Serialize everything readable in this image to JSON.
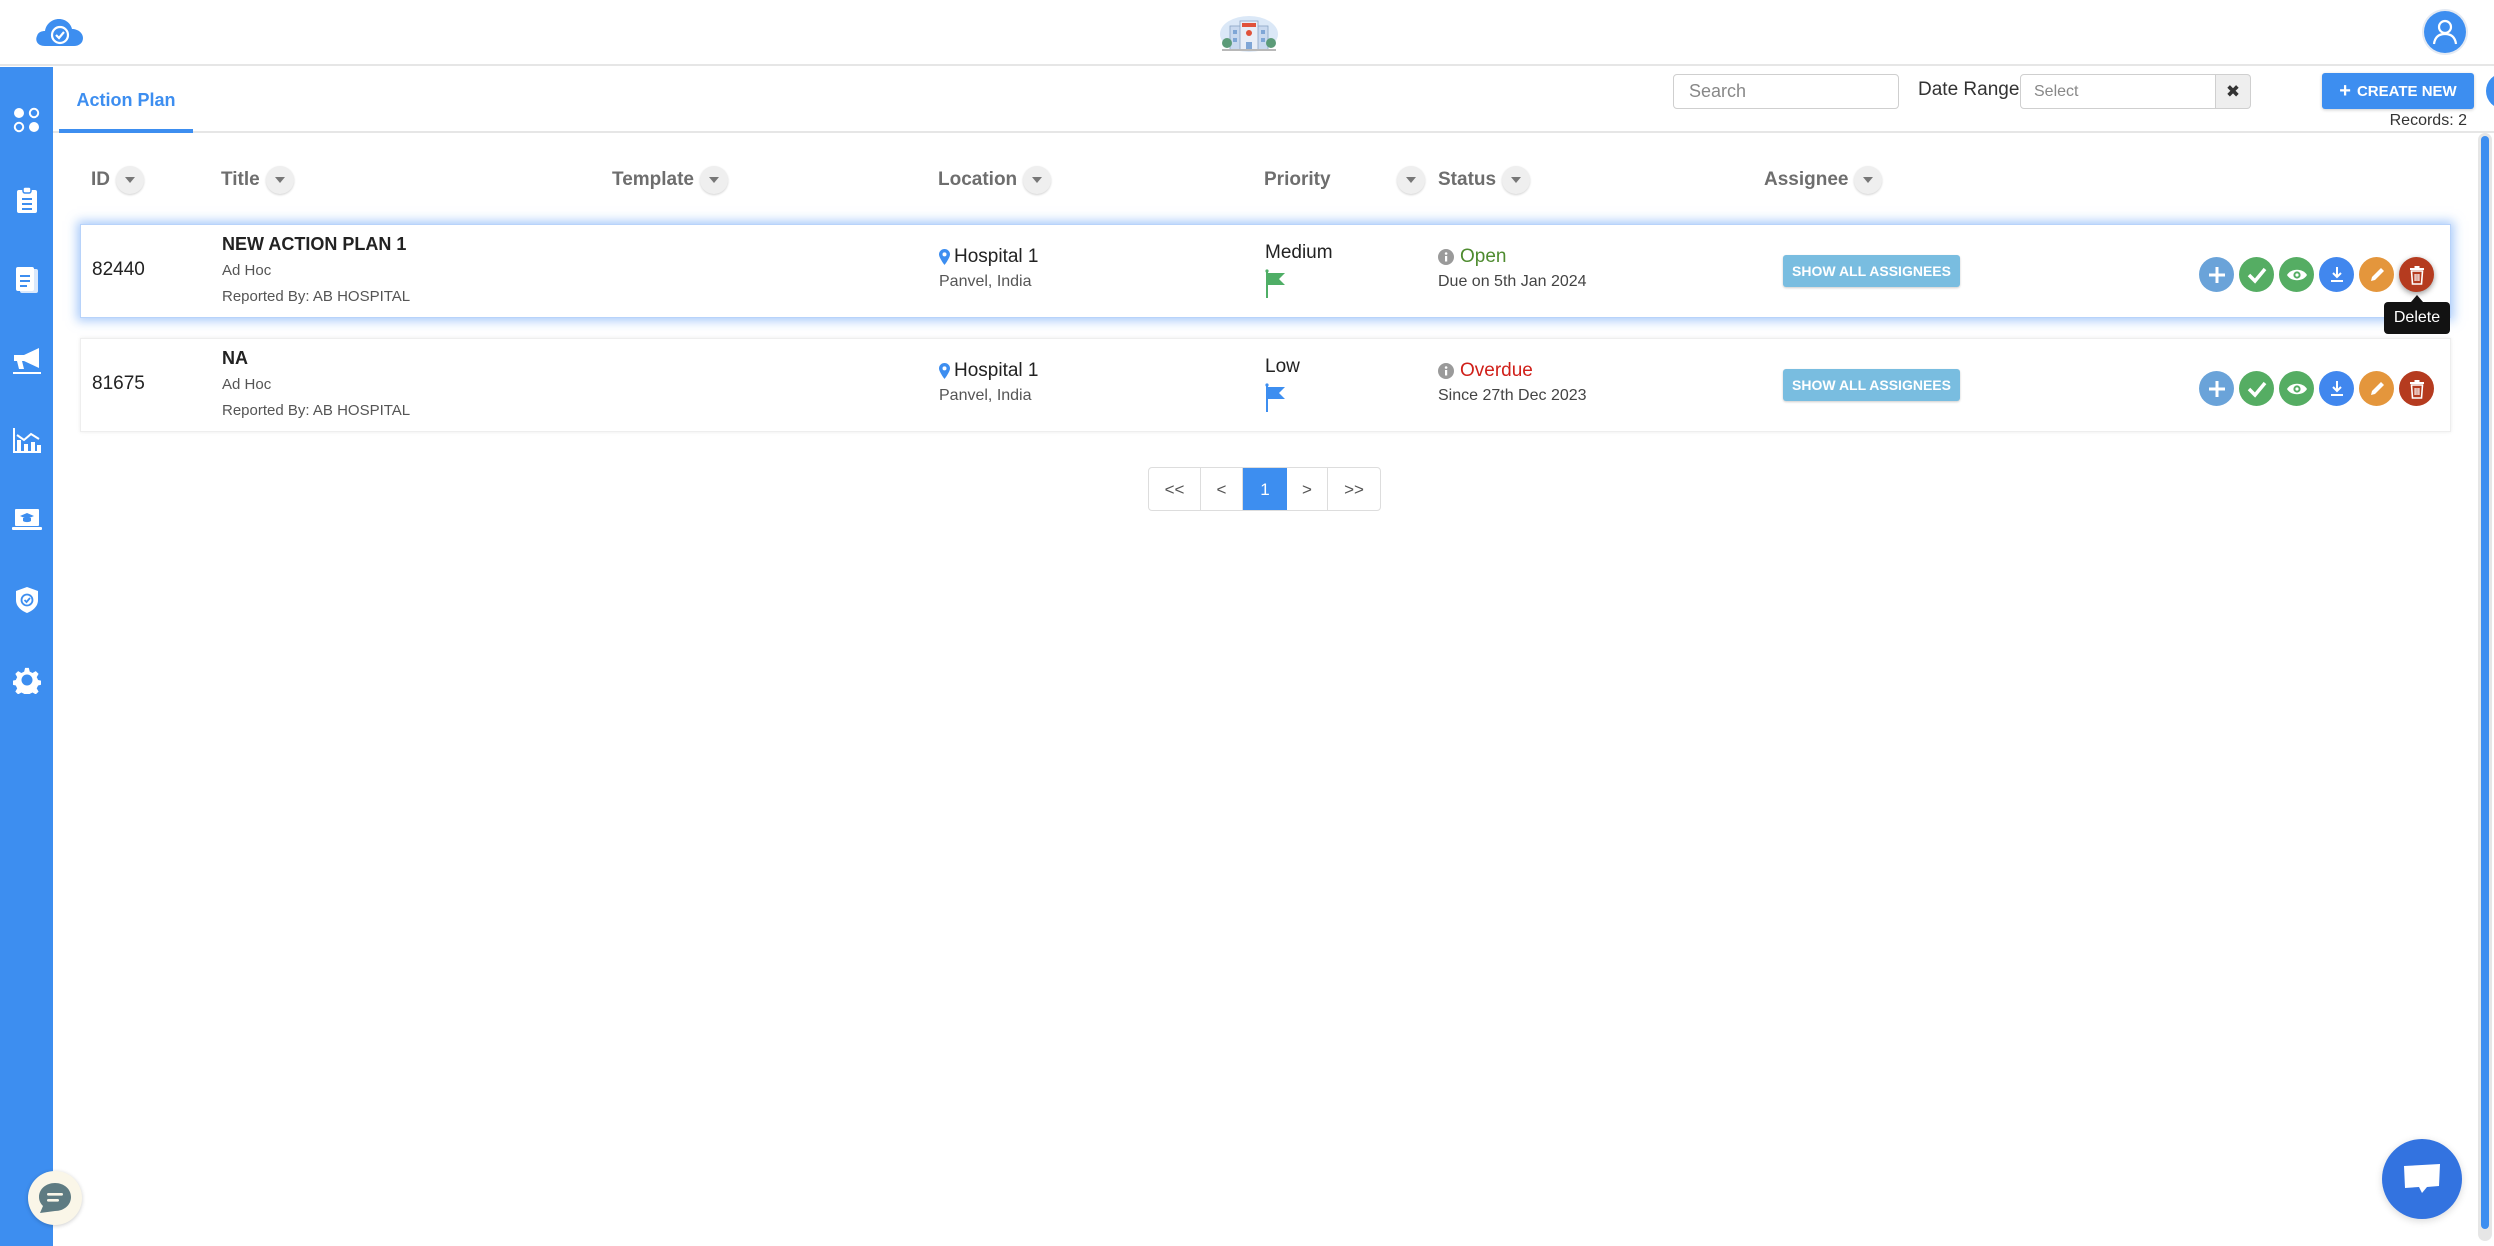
{
  "header": {
    "logo_icon": "cloud-check-icon",
    "center_logo_icon": "hospital-building-icon",
    "avatar_icon": "user-icon"
  },
  "sidebar": {
    "items": [
      {
        "icon": "dashboard-dots-icon"
      },
      {
        "icon": "clipboard-icon"
      },
      {
        "icon": "documents-icon"
      },
      {
        "icon": "megaphone-icon"
      },
      {
        "icon": "analytics-chart-icon"
      },
      {
        "icon": "training-laptop-icon"
      },
      {
        "icon": "shield-check-icon"
      },
      {
        "icon": "settings-gear-icon"
      }
    ],
    "chat_icon": "chat-lines-icon"
  },
  "subheader": {
    "tab_label": "Action Plan",
    "search_placeholder": "Search",
    "date_range_label": "Date Range",
    "date_range_placeholder": "Select",
    "clear_icon": "✖",
    "create_label": "CREATE NEW",
    "create_icon": "+",
    "records_text": "Records: 2"
  },
  "columns": [
    {
      "label": "ID"
    },
    {
      "label": "Title"
    },
    {
      "label": "Template"
    },
    {
      "label": "Location"
    },
    {
      "label": "Priority"
    },
    {
      "label": "Status"
    },
    {
      "label": "Assignee"
    }
  ],
  "rows": [
    {
      "id": "82440",
      "title": "NEW ACTION PLAN 1",
      "type": "Ad Hoc",
      "reported_by": "Reported By: AB HOSPITAL",
      "template": "",
      "location": "Hospital 1",
      "location_sub": "Panvel, India",
      "priority": "Medium",
      "priority_color": "#4fae66",
      "status": "Open",
      "status_color": "#4e8b2f",
      "status_sub": "Due on 5th Jan 2024",
      "assignee_button": "SHOW ALL ASSIGNEES"
    },
    {
      "id": "81675",
      "title": "NA",
      "type": "Ad Hoc",
      "reported_by": "Reported By: AB HOSPITAL",
      "template": "",
      "location": "Hospital 1",
      "location_sub": "Panvel, India",
      "priority": "Low",
      "priority_color": "#3d8ef0",
      "status": "Overdue",
      "status_color": "#d0201a",
      "status_sub": "Since 27th Dec 2023",
      "assignee_button": "SHOW ALL ASSIGNEES"
    }
  ],
  "row_actions": [
    "add",
    "complete",
    "view",
    "download",
    "edit",
    "delete"
  ],
  "tooltip": "Delete",
  "pagination": {
    "first": "<<",
    "prev": "<",
    "current": "1",
    "next": ">",
    "last": ">>"
  },
  "colors": {
    "accent": "#3d8ef0",
    "sidebar": "#3d8ef0",
    "assign_button": "#79bde0",
    "delete": "#b53b1f",
    "edit": "#e4963c"
  }
}
